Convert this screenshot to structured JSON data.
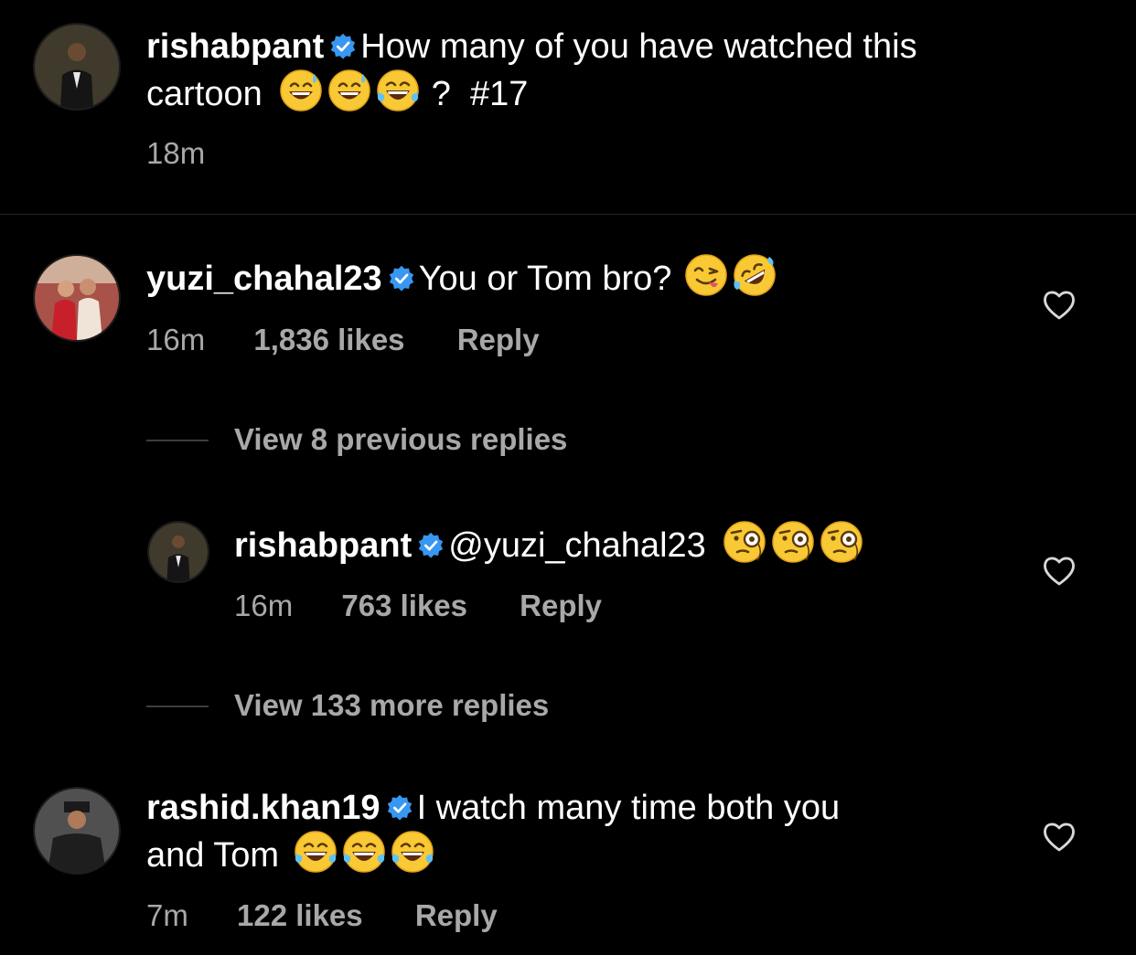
{
  "caption": {
    "username": "rishabpant",
    "text_line1": "How many of you have watched this",
    "text_line2_prefix": "cartoon",
    "emojis": [
      "sweat-smile-emoji",
      "sweat-smile-emoji",
      "tears-of-joy-emoji"
    ],
    "text_line2_suffix": "?  #17",
    "time": "18m"
  },
  "comments": [
    {
      "username": "yuzi_chahal23",
      "text": "You or Tom bro?",
      "emojis": [
        "yum-emoji",
        "rofl-emoji"
      ],
      "time": "16m",
      "likes": "1,836 likes",
      "reply_label": "Reply"
    },
    {
      "username": "rishabpant",
      "text": "@yuzi_chahal23",
      "emojis": [
        "monocle-emoji",
        "monocle-emoji",
        "monocle-emoji"
      ],
      "time": "16m",
      "likes": "763 likes",
      "reply_label": "Reply"
    },
    {
      "username": "rashid.khan19",
      "text_line1": "I watch many time both you",
      "text_line2": "and Tom",
      "emojis": [
        "tears-of-joy-emoji",
        "tears-of-joy-emoji",
        "tears-of-joy-emoji"
      ],
      "time": "7m",
      "likes": "122 likes",
      "reply_label": "Reply"
    }
  ],
  "view_previous": "View 8 previous replies",
  "view_more": "View 133 more replies",
  "colors": {
    "background": "#000000",
    "text": "#ffffff",
    "muted": "#a8a8a8",
    "verified": "#3897f0",
    "divider": "#262626"
  },
  "icons": [
    "verified-badge-icon",
    "heart-icon"
  ]
}
